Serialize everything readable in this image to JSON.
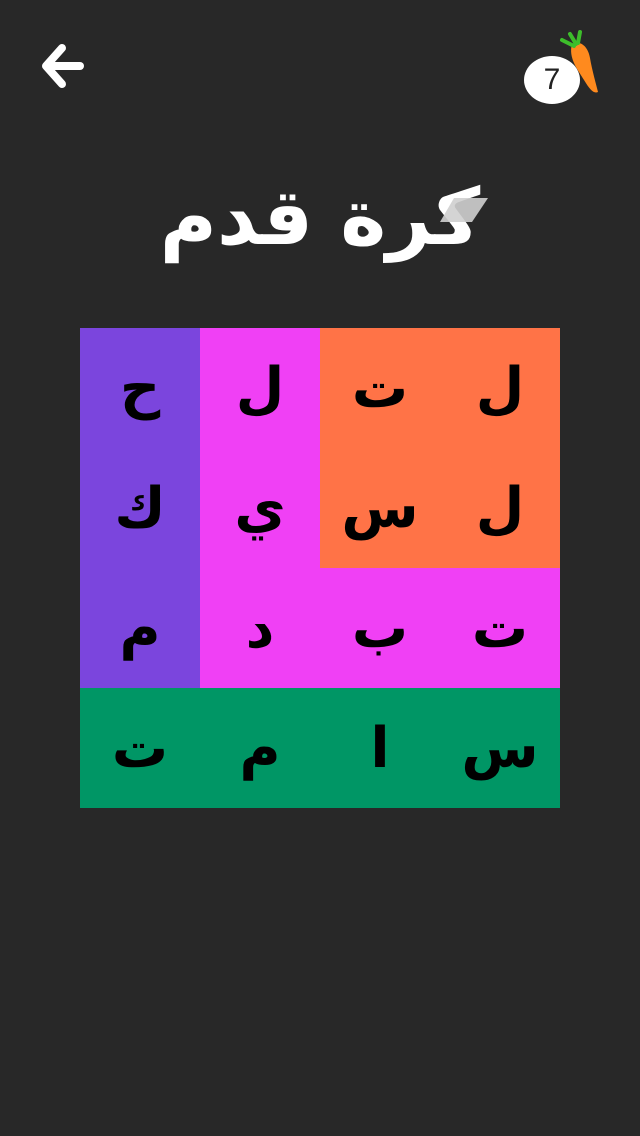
{
  "header": {
    "back_icon": "arrow-left-icon",
    "hints": {
      "count": "7",
      "icon": "carrot-icon"
    }
  },
  "clue": {
    "title": "كرة قدم"
  },
  "board": {
    "rows": 4,
    "cols": 4,
    "colors": {
      "orange": "#FF7347",
      "magenta": "#F040F5",
      "purple": "#7B45DD",
      "green": "#009665",
      "background": "#282828"
    },
    "cells": [
      [
        {
          "letter": "ح",
          "color": "#7B45DD"
        },
        {
          "letter": "ل",
          "color": "#F040F5"
        },
        {
          "letter": "ت",
          "color": "#FF7347"
        },
        {
          "letter": "ل",
          "color": "#FF7347"
        }
      ],
      [
        {
          "letter": "ك",
          "color": "#7B45DD"
        },
        {
          "letter": "ي",
          "color": "#F040F5"
        },
        {
          "letter": "س",
          "color": "#FF7347"
        },
        {
          "letter": "ل",
          "color": "#FF7347"
        }
      ],
      [
        {
          "letter": "م",
          "color": "#7B45DD"
        },
        {
          "letter": "د",
          "color": "#F040F5"
        },
        {
          "letter": "ب",
          "color": "#F040F5"
        },
        {
          "letter": "ت",
          "color": "#F040F5"
        }
      ],
      [
        {
          "letter": "ت",
          "color": "#009665"
        },
        {
          "letter": "م",
          "color": "#009665"
        },
        {
          "letter": "ا",
          "color": "#009665"
        },
        {
          "letter": "س",
          "color": "#009665"
        }
      ]
    ]
  }
}
